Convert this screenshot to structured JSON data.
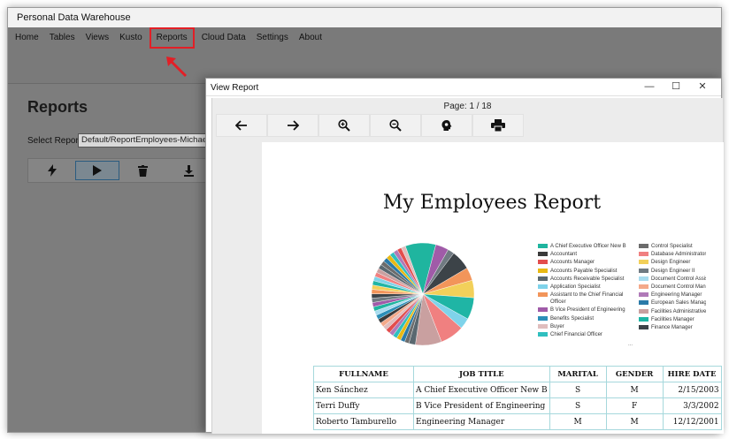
{
  "app": {
    "title": "Personal Data Warehouse",
    "menu": [
      "Home",
      "Tables",
      "Views",
      "Kusto",
      "Reports",
      "Cloud Data",
      "Settings",
      "About"
    ],
    "highlighted_menu": "Reports",
    "highlight_color": "#e21f26"
  },
  "reports_page": {
    "title": "Reports",
    "select_label": "Select Report:",
    "select_value": "Default/ReportEmployees-Michael-Washington",
    "toolbar_icons": [
      "lightning-icon",
      "play-icon",
      "trash-icon",
      "download-icon"
    ]
  },
  "dialog": {
    "title": "View Report",
    "window_controls": [
      "—",
      "☐",
      "✕"
    ],
    "page_indicator": "Page: 1 / 18",
    "nav_icons": [
      "back-arrow-icon",
      "forward-arrow-icon",
      "zoom-in-icon",
      "zoom-out-icon",
      "head-icon",
      "print-icon"
    ]
  },
  "report": {
    "title": "My Employees Report",
    "legend_col1": [
      {
        "label": "A Chief Executive Officer New B",
        "color": "#1fb59f"
      },
      {
        "label": "Accountant",
        "color": "#3a3a3a"
      },
      {
        "label": "Accounts Manager",
        "color": "#e34d4d"
      },
      {
        "label": "Accounts Payable Specialist",
        "color": "#e8b914"
      },
      {
        "label": "Accounts Receivable Specialist",
        "color": "#5a6870"
      },
      {
        "label": "Application Specialist",
        "color": "#7fd3ea"
      },
      {
        "label": "Assistant to the Chief Financial Officer",
        "color": "#f2955a"
      },
      {
        "label": "B Vice President of Engineering",
        "color": "#a05ba8"
      },
      {
        "label": "Benefits Specialist",
        "color": "#2c8fb8"
      },
      {
        "label": "Buyer",
        "color": "#e0bdbd"
      },
      {
        "label": "Chief Financial Officer",
        "color": "#2fbfbf"
      }
    ],
    "legend_col2": [
      {
        "label": "Control Specialist",
        "color": "#6c6c6c"
      },
      {
        "label": "Database Administrator",
        "color": "#f08080"
      },
      {
        "label": "Design Engineer",
        "color": "#f2d05a"
      },
      {
        "label": "Design Engineer II",
        "color": "#707a82"
      },
      {
        "label": "Document Control Assistant",
        "color": "#a8dcef"
      },
      {
        "label": "Document Control Manager",
        "color": "#f4a98a"
      },
      {
        "label": "Engineering Manager",
        "color": "#b07ab8"
      },
      {
        "label": "European Sales Manager",
        "color": "#2b7aa8"
      },
      {
        "label": "Facilities Administrative Assistant",
        "color": "#c9a0a0"
      },
      {
        "label": "Facilities Manager",
        "color": "#1fb5a5"
      },
      {
        "label": "Finance Manager",
        "color": "#3c4348"
      }
    ],
    "legend_more": "...",
    "table": {
      "headers": [
        "FULLNAME",
        "JOB TITLE",
        "MARITAL",
        "GENDER",
        "HIRE DATE"
      ],
      "rows": [
        [
          "Ken Sánchez",
          "A Chief Executive Officer New B",
          "S",
          "M",
          "2/15/2003"
        ],
        [
          "Terri Duffy",
          "B Vice President of Engineering",
          "S",
          "F",
          "3/3/2002"
        ],
        [
          "Roberto Tamburello",
          "Engineering Manager",
          "M",
          "M",
          "12/12/2001"
        ]
      ]
    }
  }
}
